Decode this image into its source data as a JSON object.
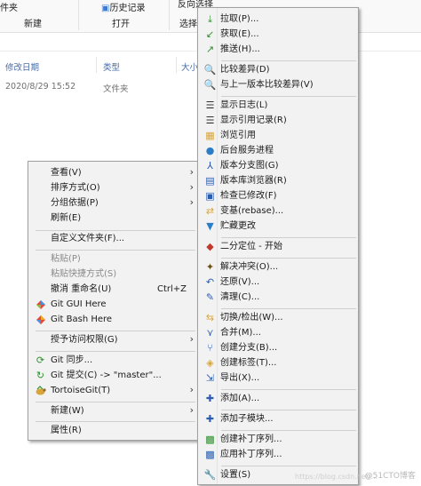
{
  "explorer": {
    "ribbon": {
      "folder_tab": "件夹",
      "new_group": "新建",
      "open_group": "打开",
      "history_button": "历史记录",
      "select_group": "选择",
      "reverse_select": "反向选择"
    },
    "columns": [
      "修改日期",
      "类型",
      "大小"
    ],
    "row": {
      "date": "2020/8/29 15:52",
      "type": "文件夹"
    }
  },
  "context_menu": {
    "items": [
      {
        "label": "查看(V)",
        "submenu": true
      },
      {
        "label": "排序方式(O)",
        "submenu": true
      },
      {
        "label": "分组依据(P)",
        "submenu": true
      },
      {
        "label": "刷新(E)"
      },
      {
        "label": "自定义文件夹(F)..."
      },
      {
        "label": "粘贴(P)",
        "disabled": true
      },
      {
        "label": "粘贴快捷方式(S)",
        "disabled": true
      },
      {
        "label": "撤消 重命名(U)",
        "shortcut": "Ctrl+Z"
      },
      {
        "label": "Git GUI Here",
        "icon": "git-gui-icon"
      },
      {
        "label": "Git Bash Here",
        "icon": "git-bash-icon"
      },
      {
        "label": "授予访问权限(G)",
        "submenu": true
      },
      {
        "label": "Git 同步...",
        "icon": "git-sync-icon"
      },
      {
        "label": "Git 提交(C) -> \"master\"...",
        "icon": "git-commit-icon"
      },
      {
        "label": "TortoiseGit(T)",
        "icon": "tortoisegit-icon",
        "submenu": true
      },
      {
        "label": "新建(W)",
        "submenu": true
      },
      {
        "label": "属性(R)"
      }
    ]
  },
  "tortoise_menu": {
    "items": [
      {
        "label": "拉取(P)...",
        "icon": "pull-icon"
      },
      {
        "label": "获取(E)...",
        "icon": "fetch-icon"
      },
      {
        "label": "推送(H)...",
        "icon": "push-icon"
      },
      {
        "label": "比较差异(D)",
        "icon": "diff-icon"
      },
      {
        "label": "与上一版本比较差异(V)",
        "icon": "diff-previous-icon"
      },
      {
        "label": "显示日志(L)",
        "icon": "log-icon"
      },
      {
        "label": "显示引用记录(R)",
        "icon": "reflog-icon"
      },
      {
        "label": "浏览引用",
        "icon": "browse-references-icon"
      },
      {
        "label": "后台服务进程",
        "icon": "daemon-icon"
      },
      {
        "label": "版本分支图(G)",
        "icon": "revision-graph-icon"
      },
      {
        "label": "版本库浏览器(R)",
        "icon": "repo-browser-icon"
      },
      {
        "label": "检查已修改(F)",
        "icon": "check-modifications-icon"
      },
      {
        "label": "变基(rebase)...",
        "icon": "rebase-icon"
      },
      {
        "label": "贮藏更改",
        "icon": "stash-icon"
      },
      {
        "label": "二分定位 - 开始",
        "icon": "bisect-icon"
      },
      {
        "label": "解决冲突(O)...",
        "icon": "resolve-icon"
      },
      {
        "label": "还原(V)...",
        "icon": "revert-icon"
      },
      {
        "label": "清理(C)...",
        "icon": "cleanup-icon"
      },
      {
        "label": "切换/检出(W)...",
        "icon": "switch-icon"
      },
      {
        "label": "合并(M)...",
        "icon": "merge-icon"
      },
      {
        "label": "创建分支(B)...",
        "icon": "branch-icon"
      },
      {
        "label": "创建标签(T)...",
        "icon": "tag-icon"
      },
      {
        "label": "导出(X)...",
        "icon": "export-icon"
      },
      {
        "label": "添加(A)...",
        "icon": "add-icon"
      },
      {
        "label": "添加子模块...",
        "icon": "add-submodule-icon"
      },
      {
        "label": "创建补丁序列...",
        "icon": "create-patch-icon"
      },
      {
        "label": "应用补丁序列...",
        "icon": "apply-patch-icon"
      },
      {
        "label": "设置(S)",
        "icon": "settings-icon"
      }
    ]
  },
  "watermark": "@51CTO博客",
  "watermark_faint": "https://blog.csdn.net/...",
  "colors": {
    "menu_bg": "#f2f2f2",
    "border": "#a0a0a0",
    "header_text": "#4a6ea8"
  }
}
